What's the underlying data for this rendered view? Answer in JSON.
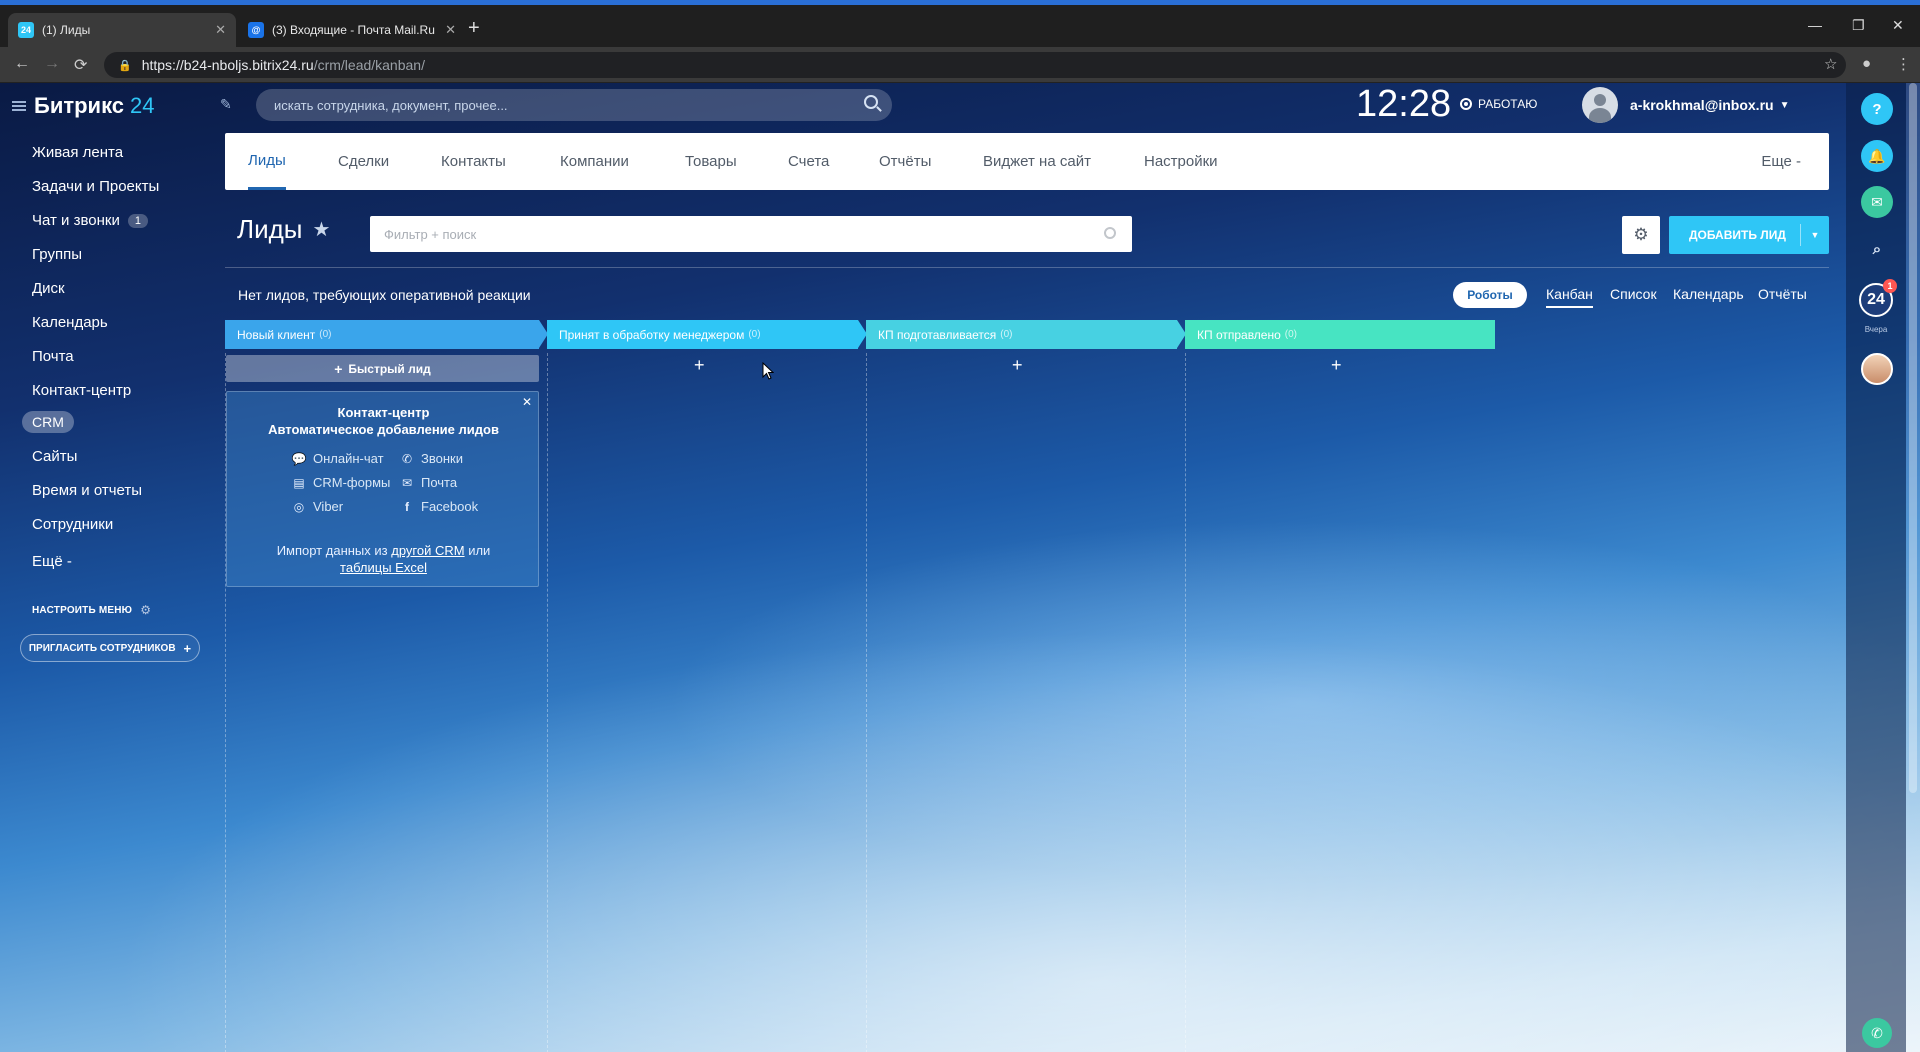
{
  "browser": {
    "tabs": [
      {
        "title": "(1) Лиды",
        "favicon": "24",
        "active": true
      },
      {
        "title": "(3) Входящие - Почта Mail.Ru",
        "favicon": "@",
        "active": false
      }
    ],
    "url_host": "https://b24-nboljs.bitrix24.ru",
    "url_path": "/crm/lead/kanban/"
  },
  "app": {
    "logo_name": "Битрикс",
    "logo_num": "24",
    "search_placeholder": "искать сотрудника, документ, прочее...",
    "clock": "12:28",
    "work_status": "РАБОТАЮ",
    "user_email": "a-krokhmal@inbox.ru"
  },
  "leftmenu": {
    "items": [
      {
        "label": "Живая лента"
      },
      {
        "label": "Задачи и Проекты"
      },
      {
        "label": "Чат и звонки",
        "badge": "1"
      },
      {
        "label": "Группы"
      },
      {
        "label": "Диск"
      },
      {
        "label": "Календарь"
      },
      {
        "label": "Почта"
      },
      {
        "label": "Контакт-центр"
      },
      {
        "label": "CRM",
        "active": true
      },
      {
        "label": "Сайты"
      },
      {
        "label": "Время и отчеты"
      },
      {
        "label": "Сотрудники"
      },
      {
        "label": "Ещё -"
      }
    ],
    "configure": "НАСТРОИТЬ МЕНЮ",
    "invite": "ПРИГЛАСИТЬ СОТРУДНИКОВ"
  },
  "crmnav": {
    "items": [
      "Лиды",
      "Сделки",
      "Контакты",
      "Компании",
      "Товары",
      "Счета",
      "Отчёты",
      "Виджет на сайт",
      "Настройки"
    ],
    "more": "Еще -"
  },
  "page": {
    "title": "Лиды",
    "filter_placeholder": "Фильтр + поиск",
    "add_button": "ДОБАВИТЬ ЛИД",
    "status_text": "Нет лидов, требующих оперативной реакции",
    "robots": "Роботы",
    "views": [
      "Канбан",
      "Список",
      "Календарь",
      "Отчёты"
    ]
  },
  "kanban": {
    "columns": [
      {
        "name": "Новый клиент",
        "count": "(0)",
        "color": "#3aa5eb"
      },
      {
        "name": "Принят в обработку менеджером",
        "count": "(0)",
        "color": "#2fc6f6"
      },
      {
        "name": "КП подготавливается",
        "count": "(0)",
        "color": "#47d1e2"
      },
      {
        "name": "КП отправлено",
        "count": "(0)",
        "color": "#47e4c2"
      }
    ],
    "quick_lead": "Быстрый лид",
    "plus": "+"
  },
  "card": {
    "title": "Контакт-центр",
    "subtitle": "Автоматическое добавление лидов",
    "sources": [
      "Онлайн-чат",
      "Звонки",
      "CRM-формы",
      "Почта",
      "Viber",
      "Facebook"
    ],
    "import_prefix": "Импорт данных из",
    "import_link1": "другой CRM",
    "import_mid": "или",
    "import_link2": "таблицы Excel"
  },
  "rightbar": {
    "help": "?",
    "badge_24": "24",
    "badge_count": "1",
    "label_24": "Вчера"
  }
}
